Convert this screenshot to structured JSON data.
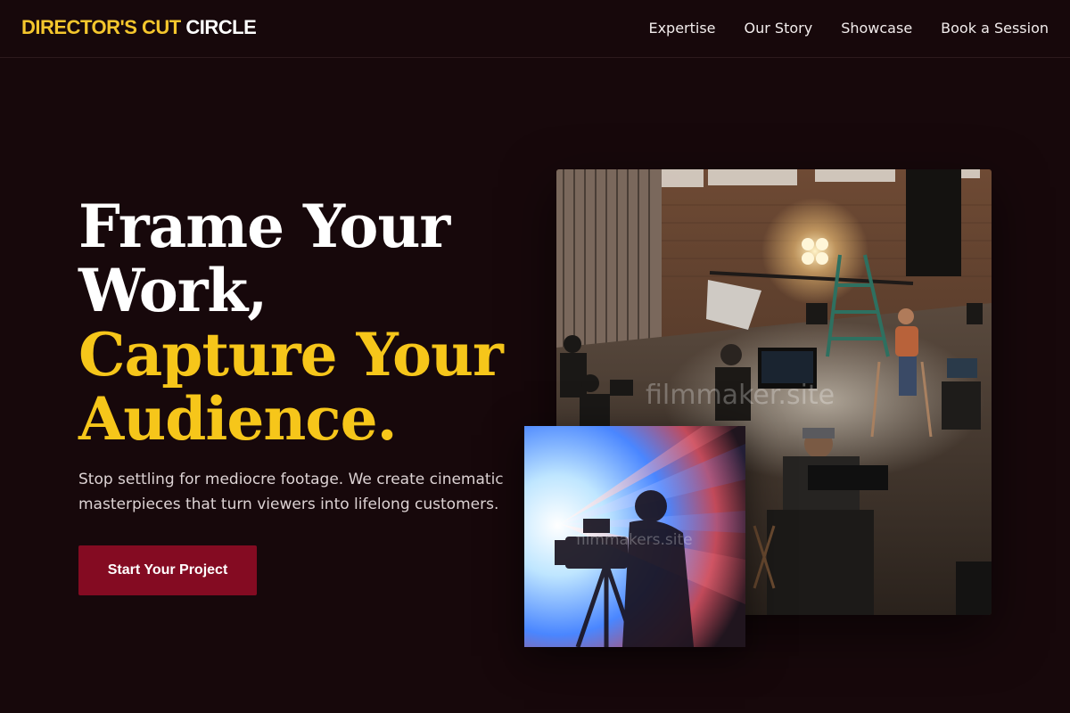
{
  "brand": {
    "accent_text": "DIRECTOR'S CUT",
    "plain_text": "CIRCLE",
    "accent_color": "#f4c62d"
  },
  "nav": {
    "items": [
      {
        "label": "Expertise"
      },
      {
        "label": "Our Story"
      },
      {
        "label": "Showcase"
      },
      {
        "label": "Book a Session"
      }
    ]
  },
  "hero": {
    "line1": "Frame Your",
    "line2": "Work,",
    "line3": "Capture Your",
    "line4": "Audience.",
    "subtext": "Stop settling for mediocre footage. We create cinematic masterpieces that turn viewers into lifelong customers.",
    "cta_label": "Start Your Project",
    "cta_color": "#840b22",
    "highlight_color": "#f6c61a"
  },
  "images": {
    "main_watermark": "filmmaker.site",
    "small_watermark": "filmmakers.site"
  }
}
